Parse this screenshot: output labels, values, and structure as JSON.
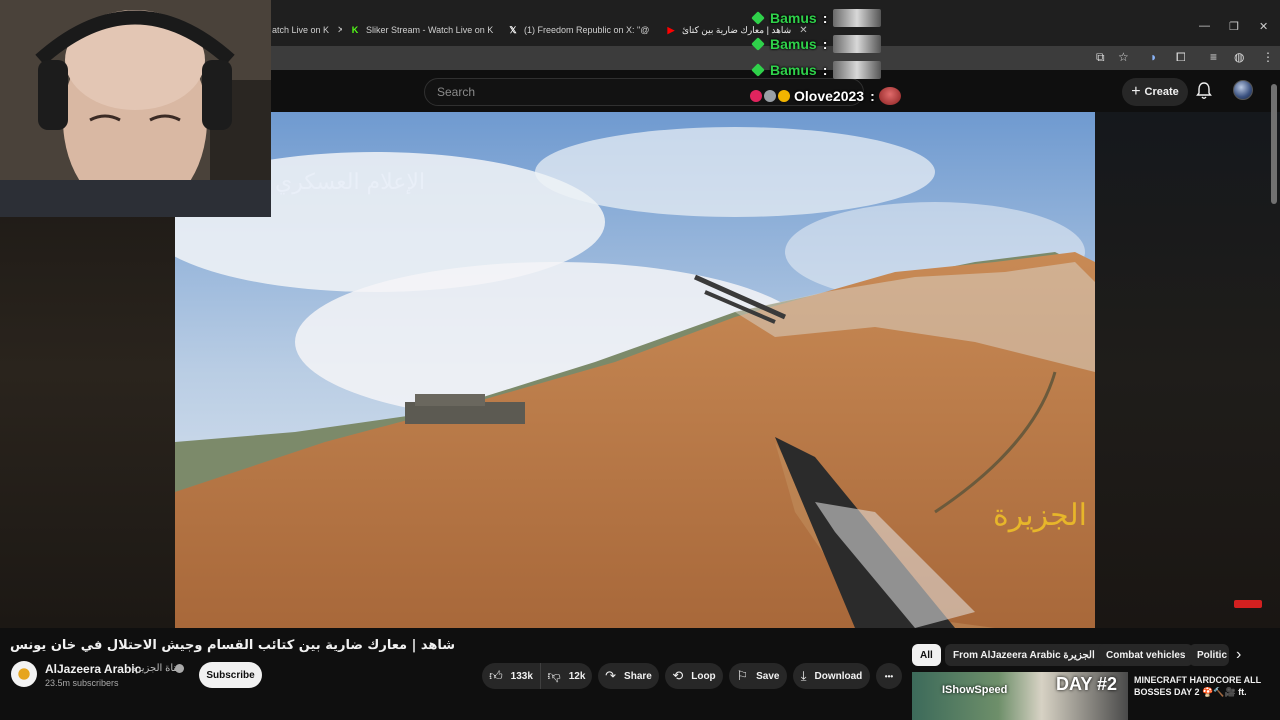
{
  "browser": {
    "tabs": [
      {
        "label": "atch Live on K",
        "favicon": "kick-icon",
        "active": false
      },
      {
        "label": "Sliker Stream - Watch Live on K",
        "favicon": "kick-icon",
        "active": false
      },
      {
        "label": "(1) Freedom Republic on X: \"@",
        "favicon": "x-icon",
        "active": false
      },
      {
        "label": "شاهد | معارك ضارية بين كتائ",
        "favicon": "youtube-icon",
        "active": true
      }
    ],
    "window_controls": [
      "—",
      "❐",
      "✕"
    ]
  },
  "youtube": {
    "search_placeholder": "Search",
    "create_label": "Create",
    "plus": "+"
  },
  "chat_overlay": [
    {
      "user": "Bamus",
      "sep": ":"
    },
    {
      "user": "Bamus",
      "sep": ":"
    },
    {
      "user": "Bamus",
      "sep": ":"
    },
    {
      "user": "Olove2023",
      "sep": ":"
    }
  ],
  "video": {
    "watermark": "الإعلام العسكري",
    "channel_logo": "الجزيرة"
  },
  "below_video": {
    "title": "شاهد | معارك ضارية بين كتائب القسام وجيش الاحتلال في خان يونس",
    "channel": {
      "name": "AlJazeera Arabic",
      "name_ar": "قناة الجزيرة",
      "subscribers": "23.5m subscribers"
    },
    "subscribe_label": "Subscribe",
    "actions": {
      "likes": "133k",
      "dislikes": "12k",
      "share": "Share",
      "loop": "Loop",
      "save": "Save",
      "download": "Download",
      "more": "•••"
    }
  },
  "chips": [
    "All",
    "From AlJazeera Arabic قناة الجزيرة",
    "Combat vehicles",
    "Politic"
  ],
  "recommended": {
    "thumb_text_a": "IShowSpeed",
    "thumb_text_b": "DAY #2",
    "title": "MINECRAFT HARDCORE ALL BOSSES DAY 2 🍄🔨🎥 ft."
  },
  "colors": {
    "background": "#0f0f0f",
    "chat_gem": "#2fd14a",
    "logo_gold": "#e7b62a"
  }
}
